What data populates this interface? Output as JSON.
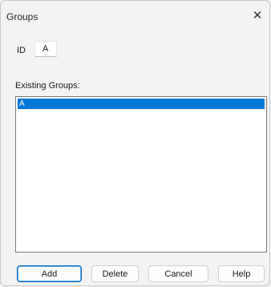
{
  "window": {
    "title": "Groups",
    "close_glyph": "✕"
  },
  "id_field": {
    "label": "ID",
    "value": "A"
  },
  "existing_groups": {
    "label": "Existing Groups:",
    "items": [
      "A"
    ],
    "selected_index": 0
  },
  "buttons": {
    "add": "Add",
    "delete": "Delete",
    "cancel": "Cancel",
    "help": "Help"
  },
  "colors": {
    "selection": "#0078d7",
    "default_button_border": "#0067c0"
  }
}
